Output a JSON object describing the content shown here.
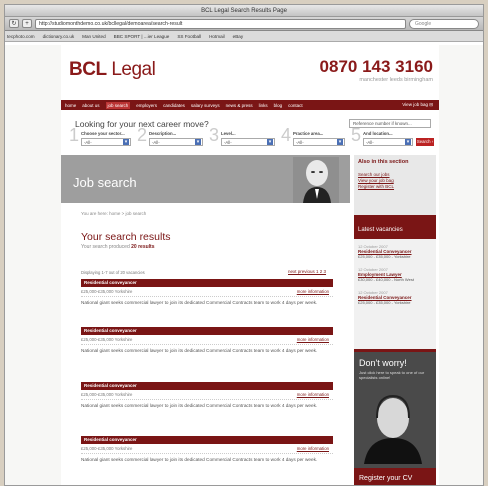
{
  "browser": {
    "title": "BCL Legal Search Results Page",
    "url": "http://studiomonthdemo.co.uk/bcllegal/demoarea/search-result",
    "search_placeholder": "Google",
    "bookmarks": [
      "tecphoto.com",
      "dictionary.co.uk",
      "Man United",
      "BBC SPORT | ...ier League",
      "SS Football",
      "Hotmail",
      "eBay"
    ]
  },
  "header": {
    "logo_prefix": "BCL",
    "logo_suffix": " Legal",
    "phone": "0870 143 3160",
    "cities": "manchester  leeds  birmingham"
  },
  "nav": {
    "items": [
      "home",
      "about us",
      "job search",
      "employers",
      "candidates",
      "salary surveys",
      "news & press",
      "links",
      "blog",
      "contact"
    ],
    "active_index": 2,
    "job_login": "View job bag"
  },
  "search": {
    "heading": "Looking for your next career move?",
    "reference_placeholder": "Reference number if known...",
    "steps": [
      {
        "num": "1",
        "label": "Choose your sector...",
        "value": "-All-"
      },
      {
        "num": "2",
        "label": "Description...",
        "value": "-All-"
      },
      {
        "num": "3",
        "label": "Level...",
        "value": "-All-"
      },
      {
        "num": "4",
        "label": "Practice area...",
        "value": "-All-"
      },
      {
        "num": "5",
        "label": "And location...",
        "value": "-All-"
      }
    ],
    "button": "Search"
  },
  "banner": {
    "title": "Job search"
  },
  "breadcrumb": "You are here: home > job search",
  "results": {
    "title": "Your search results",
    "sub_prefix": "Your search produced ",
    "count": "20 results",
    "displaying": "Displaying 1-7 out of 20 vacancies",
    "pager": "next  previous  1 2 3",
    "items": [
      {
        "title": "Residential conveyancer",
        "salary": "£25,000-£35,000  Yorkshire",
        "more": "more information",
        "desc": "National giant seeks commercial lawyer to join its dedicated Commercial Contracts team to work 4 days per week."
      },
      {
        "title": "Residential conveyancer",
        "salary": "£25,000-£35,000  Yorkshire",
        "more": "more information",
        "desc": "National giant seeks commercial lawyer to join its dedicated Commercial Contracts team to work 4 days per week."
      },
      {
        "title": "Residential conveyancer",
        "salary": "£25,000-£35,000  Yorkshire",
        "more": "more information",
        "desc": "National giant seeks commercial lawyer to join its dedicated Commercial Contracts team to work 4 days per week."
      },
      {
        "title": "Residential conveyancer",
        "salary": "£25,000-£35,000  Yorkshire",
        "more": "more information",
        "desc": "National giant seeks commercial lawyer to join its dedicated Commercial Contracts team to work 4 days per week."
      }
    ]
  },
  "sidebar": {
    "also_title": "Also in this section",
    "also_links": [
      "Search our jobs",
      "View your job bag",
      "Register with BCL"
    ],
    "latest_title": "Latest vacancies",
    "vacancies": [
      {
        "date": "12 October 2007",
        "title": "Residential Conveyancer",
        "meta": "£25,000 - £35,000 - Yorkshire"
      },
      {
        "date": "12 October 2007",
        "title": "Employment Lawyer",
        "meta": "£30,000 - £40,000 - North West"
      },
      {
        "date": "12 October 2007",
        "title": "Residential Conveyancer",
        "meta": "£25,000 - £35,000 - Yorkshire"
      }
    ],
    "dont_worry_title": "Don't worry!",
    "dont_worry_text": "Just click here to speak to one of our specialists online!",
    "register": "Register your CV"
  },
  "colors": {
    "brand": "#7a1515",
    "accent": "#b22222"
  }
}
